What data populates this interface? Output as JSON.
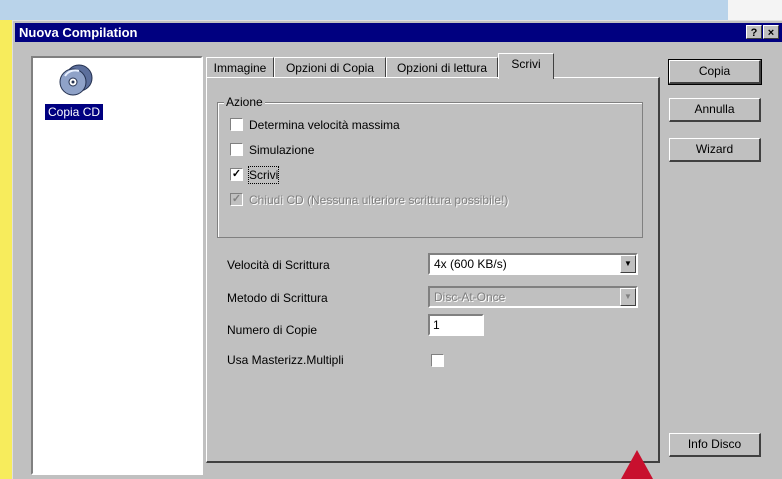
{
  "window": {
    "title": "Nuova Compilation",
    "help_label": "?",
    "close_label": "×"
  },
  "left_panel": {
    "item_label": "Copia CD",
    "item_icon": "cd-copy-icon"
  },
  "tabs": [
    {
      "label": "Immagine"
    },
    {
      "label": "Opzioni di Copia"
    },
    {
      "label": "Opzioni di lettura"
    },
    {
      "label": "Scrivi",
      "active": true
    }
  ],
  "azione": {
    "title": "Azione",
    "options": [
      {
        "label": "Determina velocità massima",
        "checked": false
      },
      {
        "label": "Simulazione",
        "checked": false
      },
      {
        "label": "Scrivi",
        "checked": true
      },
      {
        "label": "Chiudi CD (Nessuna ulteriore scrittura possibile!)",
        "checked": true,
        "disabled": true
      }
    ],
    "check_mark": "✓"
  },
  "fields": {
    "velocita_label": "Velocità di Scrittura",
    "velocita_value": "4x (600 KB/s)",
    "metodo_label": "Metodo di Scrittura",
    "metodo_value": "Disc-At-Once",
    "copie_label": "Numero di Copie",
    "copie_value": "1",
    "multipli_label": "Usa Masterizz.Multipli",
    "multipli_checked": false
  },
  "buttons": {
    "copia": "Copia",
    "annulla": "Annulla",
    "wizard": "Wizard",
    "info_disco": "Info Disco"
  },
  "colors": {
    "titlebar": "#000080",
    "face": "#c0c0c0",
    "background": "#f7ec5c",
    "marker": "#c8102e"
  }
}
